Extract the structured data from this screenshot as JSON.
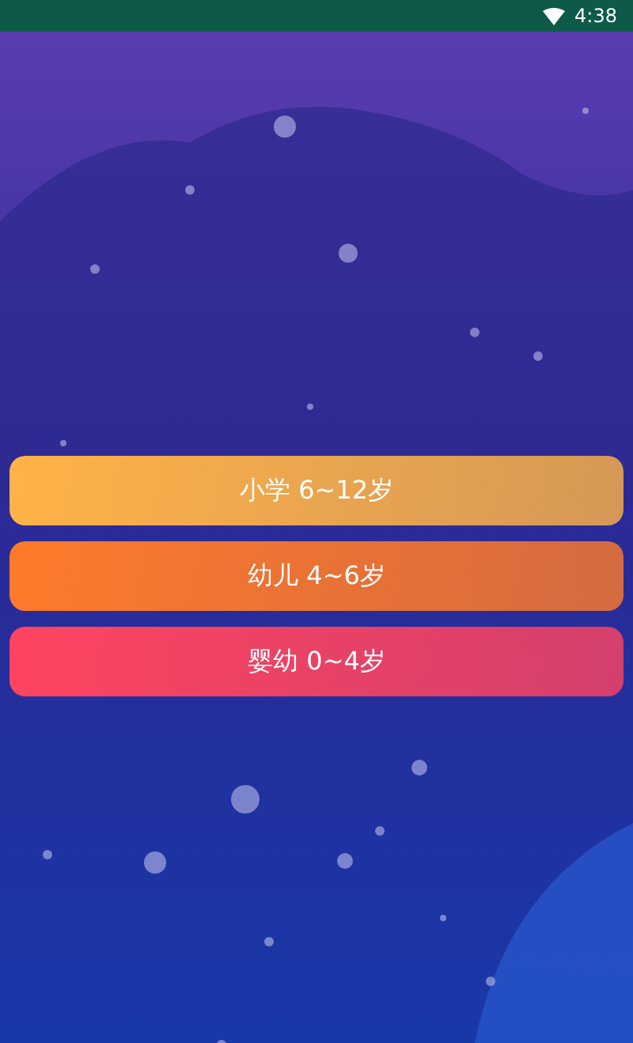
{
  "status_bar": {
    "time": "4:38"
  },
  "options": [
    {
      "label": "小学 6~12岁",
      "color": "#ffb347"
    },
    {
      "label": "幼儿 4~6岁",
      "color": "#ff7a2a"
    },
    {
      "label": "婴幼 0~4岁",
      "color": "#ff4460"
    }
  ]
}
